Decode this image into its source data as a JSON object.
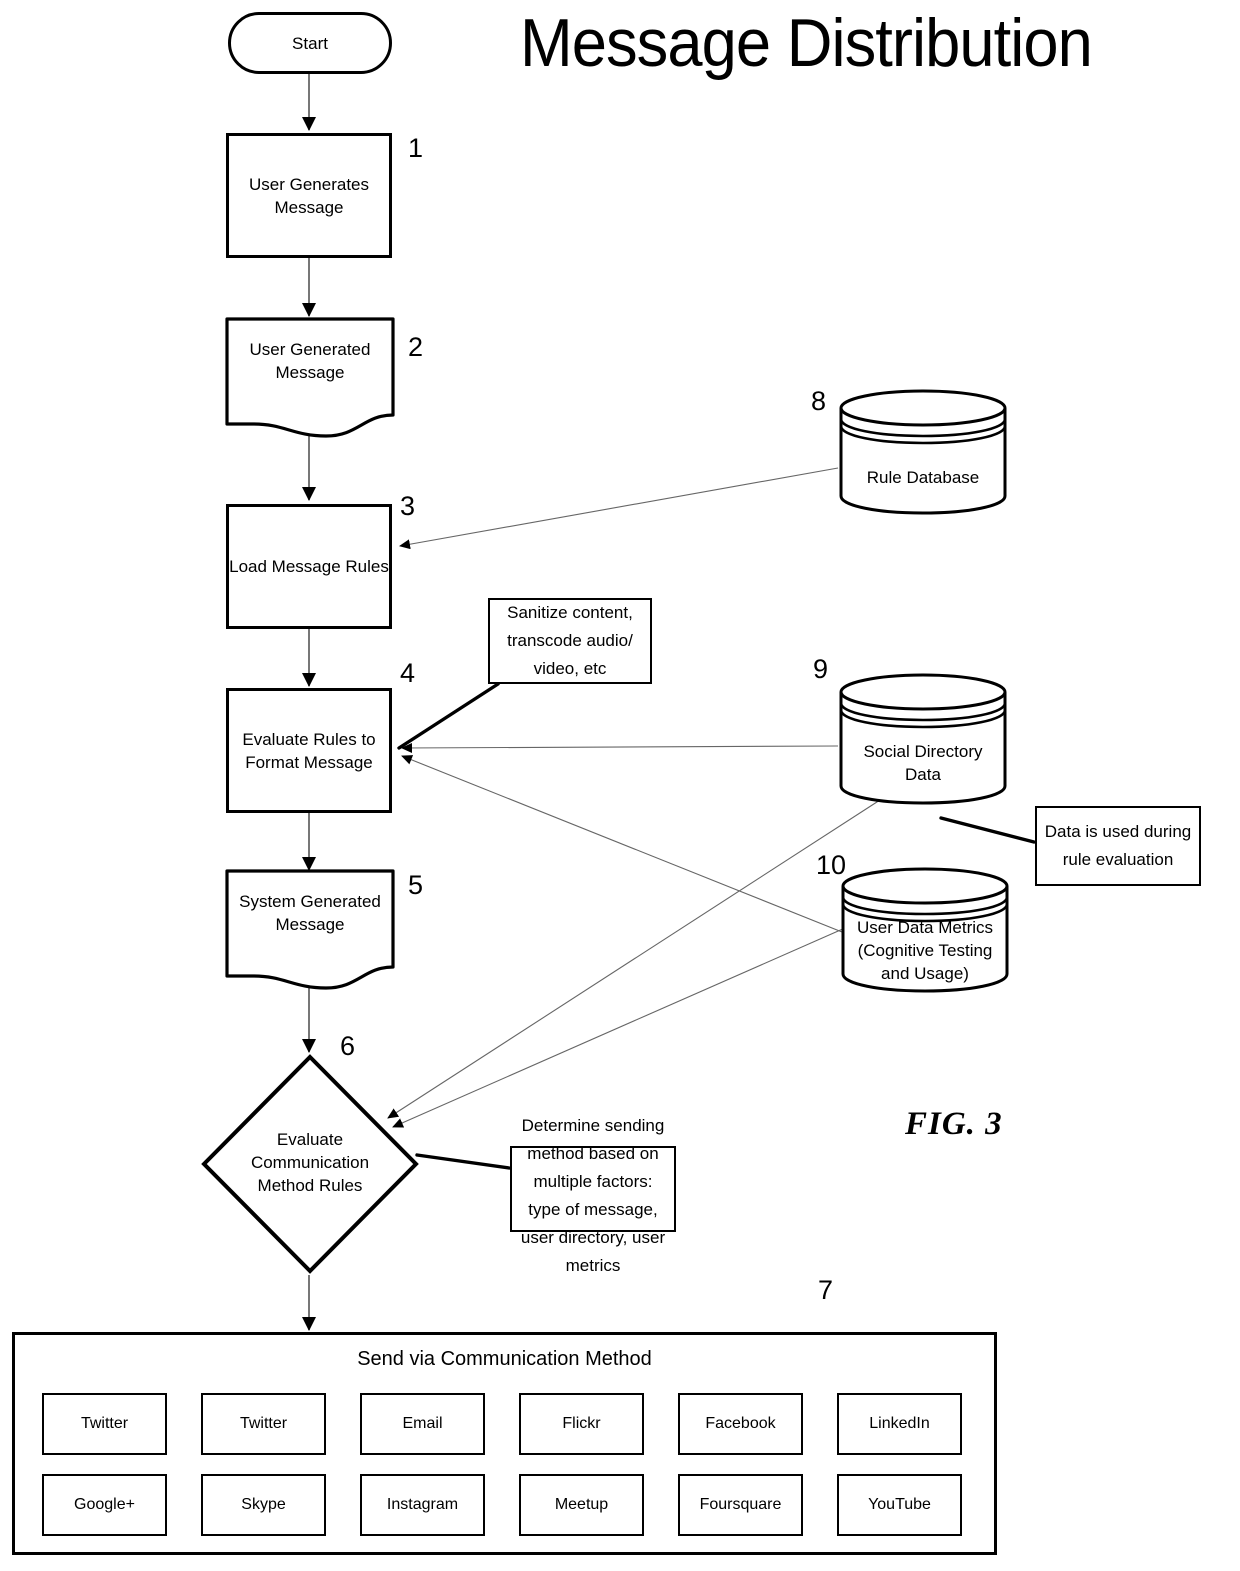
{
  "figure": {
    "title": "Message Distribution",
    "figure_label": "FIG. 3"
  },
  "nodes": {
    "start": {
      "label": "Start"
    },
    "n1": {
      "ref": "1",
      "label": "User Generates\nMessage"
    },
    "n2": {
      "ref": "2",
      "label": "User Generated\nMessage"
    },
    "n3": {
      "ref": "3",
      "label": "Load Message Rules"
    },
    "n4": {
      "ref": "4",
      "label": "Evaluate Rules to\nFormat Message"
    },
    "n5": {
      "ref": "5",
      "label": "System Generated\nMessage"
    },
    "n6": {
      "ref": "6",
      "label": "Evaluate\nCommunication\nMethod Rules"
    },
    "n7": {
      "ref": "7",
      "label": "Send via Communication Method"
    },
    "n8": {
      "ref": "8",
      "label": "Rule Database"
    },
    "n9": {
      "ref": "9",
      "label": "Social Directory\nData"
    },
    "n10": {
      "ref": "10",
      "label": "User Data Metrics\n(Cognitive Testing\nand Usage)"
    }
  },
  "annotations": {
    "format_note": "Sanitize content,\ntranscode audio/\nvideo, etc",
    "data_note": "Data is used during\nrule evaluation",
    "method_note": "Determine sending\nmethod based on\nmultiple factors:\ntype of message,\nuser directory, user\nmetrics"
  },
  "communication_methods": [
    {
      "label": "Twitter"
    },
    {
      "label": "Twitter"
    },
    {
      "label": "Email"
    },
    {
      "label": "Flickr"
    },
    {
      "label": "Facebook"
    },
    {
      "label": "LinkedIn"
    },
    {
      "label": "Google+"
    },
    {
      "label": "Skype"
    },
    {
      "label": "Instagram"
    },
    {
      "label": "Meetup"
    },
    {
      "label": "Foursquare"
    },
    {
      "label": "YouTube"
    }
  ],
  "colors": {
    "stroke": "#000000",
    "background": "#ffffff",
    "thin_connector": "#555555"
  }
}
